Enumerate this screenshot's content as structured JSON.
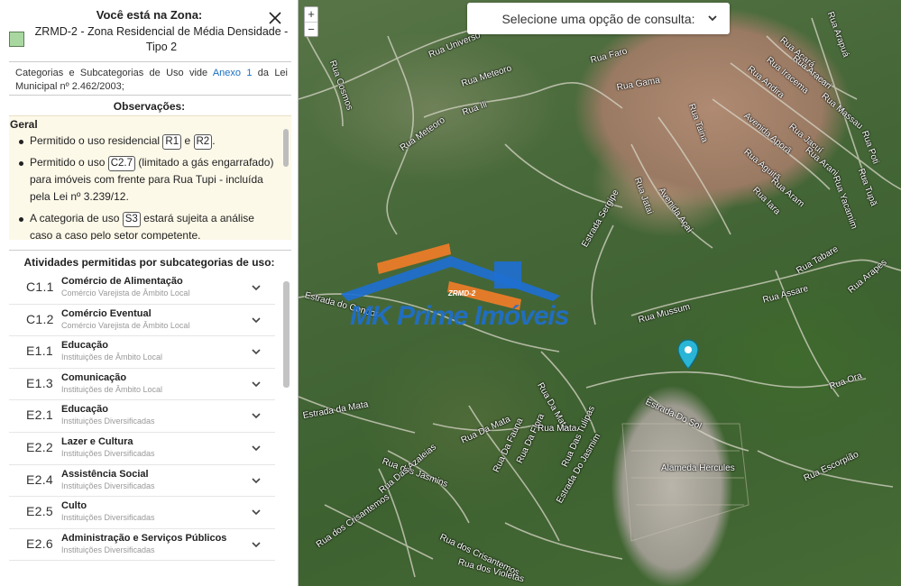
{
  "panel": {
    "zone_title": "Você está na Zona:",
    "zone_name": "ZRMD-2 - Zona Residencial de Média Densidade - Tipo 2",
    "zone_color": "#a8d8a0",
    "categories_prefix": "Categorias e Subcategorias de Uso vide",
    "categories_link": "Anexo 1",
    "categories_suffix": "da Lei Municipal nº 2.462/2003;",
    "observations_title": "Observações:",
    "observations_group": "Geral",
    "observations": [
      {
        "pre": "Permitido o uso residencial",
        "chip1": "R1",
        "mid": "e",
        "chip2": "R2",
        "post": "."
      },
      {
        "pre": "Permitido o uso",
        "chip1": "C2.7",
        "post": "(limitado a gás engarrafado) para imóveis com frente para Rua Tupi - incluída pela Lei nº 3.239/12."
      },
      {
        "pre": "A categoria de uso",
        "chip1": "S3",
        "post": "estará sujeita a análise caso a caso pelo setor competente."
      }
    ],
    "activities_title": "Atividades permitidas por subcategorias de uso:",
    "activities": [
      {
        "code": "C1.1",
        "name": "Comércio de Alimentação",
        "sub": "Comércio Varejista de Âmbito Local"
      },
      {
        "code": "C1.2",
        "name": "Comércio Eventual",
        "sub": "Comércio Varejista de Âmbito Local"
      },
      {
        "code": "E1.1",
        "name": "Educação",
        "sub": "Instituições de Âmbito Local"
      },
      {
        "code": "E1.3",
        "name": "Comunicação",
        "sub": "Instituições de Âmbito Local"
      },
      {
        "code": "E2.1",
        "name": "Educação",
        "sub": "Instituições Diversificadas"
      },
      {
        "code": "E2.2",
        "name": "Lazer e Cultura",
        "sub": "Instituições Diversificadas"
      },
      {
        "code": "E2.4",
        "name": "Assistência Social",
        "sub": "Instituições Diversificadas"
      },
      {
        "code": "E2.5",
        "name": "Culto",
        "sub": "Instituições Diversificadas"
      },
      {
        "code": "E2.6",
        "name": "Administração e Serviços Públicos",
        "sub": "Instituições Diversificadas"
      }
    ]
  },
  "map": {
    "consult_placeholder": "Selecione uma opção de consulta:",
    "zoom_in": "+",
    "zoom_out": "−",
    "watermark_text": "MK Prime Imóveis",
    "watermark_zone": "ZRMD-2",
    "road_labels": [
      "Rua Universo",
      "Rua Meteoro",
      "Rua Ili",
      "Rua Meteoro",
      "Rua Cosmos",
      "Rua Faro",
      "Rua Gama",
      "Rua Taina",
      "Rua Jatai",
      "Avenida Açaí",
      "Rua Andira",
      "Rua Iracema",
      "Avenida Aporã",
      "Rua Aguitã",
      "Rua Acará",
      "Rua Aracari",
      "Rua Massau",
      "Rua Jacuí",
      "Rua Arani",
      "Rua Aram",
      "Rua Iara",
      "Rua Yacamim",
      "Rua Tupã",
      "Rua Poti",
      "Rua Arapuá",
      "Rua Tabare",
      "Rua Assare",
      "Rua Arapes",
      "Rua Mussum",
      "Rua Ora",
      "Rua Escorpião",
      "Alameda Hercules",
      "Estrada da Mata",
      "Rua Da Mata",
      "Rua Da Mata",
      "Rua Da Fauna",
      "Rua Da Flora",
      "Rua dos Jasmins",
      "Rua Das Azaleias",
      "Rua dos Crisantemos",
      "Rua dos Crisantemos",
      "Rua dos Violetas",
      "Estrada Do Jasmim",
      "Estrada Do Sol",
      "Rua Mata",
      "Rua Das Tulipas",
      "Estrada Sergipe",
      "Estrada do Condor"
    ]
  }
}
